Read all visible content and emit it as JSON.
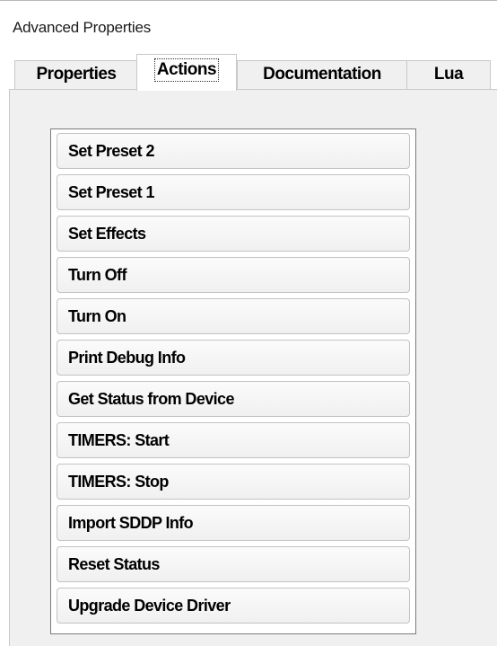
{
  "panel": {
    "title": "Advanced Properties"
  },
  "tabs": [
    {
      "label": "Properties",
      "selected": false
    },
    {
      "label": "Actions",
      "selected": true
    },
    {
      "label": "Documentation",
      "selected": false
    },
    {
      "label": "Lua",
      "selected": false
    }
  ],
  "actions": [
    {
      "label": "Set Preset 2"
    },
    {
      "label": "Set Preset 1"
    },
    {
      "label": "Set Effects"
    },
    {
      "label": "Turn Off"
    },
    {
      "label": "Turn On"
    },
    {
      "label": "Print Debug Info"
    },
    {
      "label": "Get Status from Device"
    },
    {
      "label": "TIMERS: Start"
    },
    {
      "label": "TIMERS: Stop"
    },
    {
      "label": "Import SDDP Info"
    },
    {
      "label": "Reset Status"
    },
    {
      "label": "Upgrade Device Driver"
    }
  ]
}
